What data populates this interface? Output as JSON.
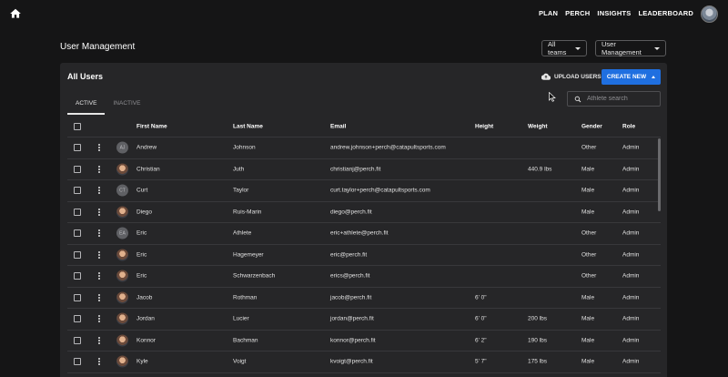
{
  "topbar": {
    "home_icon": "home-icon",
    "nav": [
      "PLAN",
      "PERCH",
      "INSIGHTS",
      "LEADERBOARD"
    ],
    "avatar_icon": "user-avatar"
  },
  "header": {
    "title": "User Management",
    "teams_dropdown": "All teams",
    "section_dropdown": "User Management"
  },
  "card": {
    "title": "All Users",
    "upload_label": "UPLOAD USERS",
    "create_label": "CREATE NEW",
    "tabs": [
      {
        "label": "ACTIVE",
        "active": true
      },
      {
        "label": "INACTIVE",
        "active": false
      }
    ],
    "search_placeholder": "Athlete search"
  },
  "table": {
    "columns": [
      "First Name",
      "Last Name",
      "Email",
      "Height",
      "Weight",
      "Gender",
      "Role"
    ],
    "rows": [
      {
        "initials": "AJ",
        "photo": false,
        "first": "Andrew",
        "last": "Johnson",
        "email": "andrew.johnson+perch@catapultsports.com",
        "height": "",
        "weight": "",
        "gender": "Other",
        "role": "Admin"
      },
      {
        "initials": "",
        "photo": true,
        "first": "Christian",
        "last": "Juth",
        "email": "christianj@perch.fit",
        "height": "",
        "weight": "440.9 lbs",
        "gender": "Male",
        "role": "Admin"
      },
      {
        "initials": "CT",
        "photo": false,
        "first": "Curt",
        "last": "Taylor",
        "email": "curt.taylor+perch@catapultsports.com",
        "height": "",
        "weight": "",
        "gender": "Male",
        "role": "Admin"
      },
      {
        "initials": "",
        "photo": true,
        "first": "Diego",
        "last": "Ruis-Marin",
        "email": "diego@perch.fit",
        "height": "",
        "weight": "",
        "gender": "Male",
        "role": "Admin"
      },
      {
        "initials": "EA",
        "photo": false,
        "first": "Eric",
        "last": "Athlete",
        "email": "eric+athlete@perch.fit",
        "height": "",
        "weight": "",
        "gender": "Other",
        "role": "Admin"
      },
      {
        "initials": "",
        "photo": true,
        "first": "Eric",
        "last": "Hagemeyer",
        "email": "eric@perch.fit",
        "height": "",
        "weight": "",
        "gender": "Other",
        "role": "Admin"
      },
      {
        "initials": "",
        "photo": true,
        "first": "Eric",
        "last": "Schwarzenbach",
        "email": "erics@perch.fit",
        "height": "",
        "weight": "",
        "gender": "Other",
        "role": "Admin"
      },
      {
        "initials": "",
        "photo": true,
        "first": "Jacob",
        "last": "Rothman",
        "email": "jacob@perch.fit",
        "height": "6' 0\"",
        "weight": "",
        "gender": "Male",
        "role": "Admin"
      },
      {
        "initials": "",
        "photo": true,
        "first": "Jordan",
        "last": "Lucier",
        "email": "jordan@perch.fit",
        "height": "6' 0\"",
        "weight": "200 lbs",
        "gender": "Male",
        "role": "Admin"
      },
      {
        "initials": "",
        "photo": true,
        "first": "Konnor",
        "last": "Bachman",
        "email": "konnor@perch.fit",
        "height": "6' 2\"",
        "weight": "190 lbs",
        "gender": "Male",
        "role": "Admin"
      },
      {
        "initials": "",
        "photo": true,
        "first": "Kyle",
        "last": "Voigt",
        "email": "kvoigt@perch.fit",
        "height": "5' 7\"",
        "weight": "175 lbs",
        "gender": "Male",
        "role": "Admin"
      }
    ]
  },
  "colors": {
    "accent": "#1f6fe0",
    "background": "#151516",
    "card": "#262628"
  }
}
